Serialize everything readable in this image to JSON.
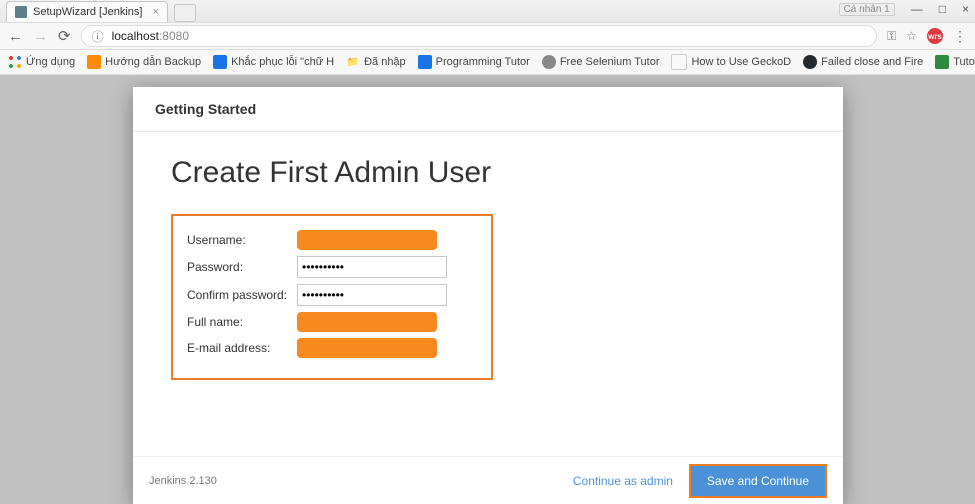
{
  "browser": {
    "tab_title": "SetupWizard [Jenkins]",
    "window_user": "Cá nhân 1",
    "url_host": "localhost",
    "url_port": ":8080",
    "ext_badge": "wrs"
  },
  "bookmarks": {
    "apps": "Ứng dụng",
    "items": [
      "Hướng dẫn Backup",
      "Khắc phục lỗi \"chữ H",
      "Đã nhập",
      "Programming Tutor",
      "Free Selenium Tutor",
      "How to Use GeckoD",
      "Failed close and Fire",
      "Tutorials for Sencha"
    ]
  },
  "modal": {
    "header": "Getting Started",
    "title": "Create First Admin User",
    "labels": {
      "username": "Username:",
      "password": "Password:",
      "confirm": "Confirm password:",
      "fullname": "Full name:",
      "email": "E-mail address:"
    },
    "values": {
      "password": "••••••••••",
      "confirm": "••••••••••"
    },
    "footer_version": "Jenkins 2.130",
    "continue_as_admin": "Continue as admin",
    "save_and_continue": "Save and Continue"
  }
}
